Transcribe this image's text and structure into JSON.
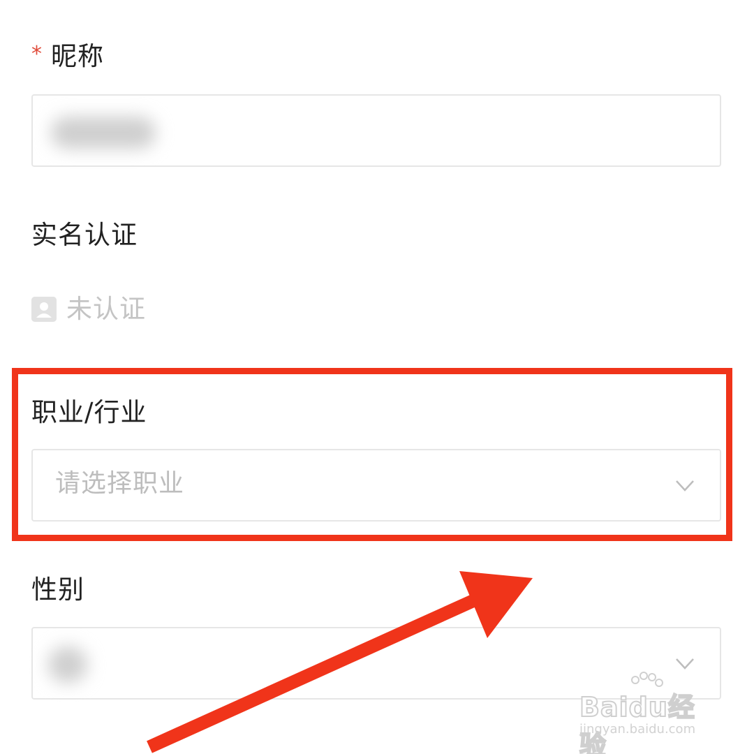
{
  "form": {
    "nickname": {
      "required_mark": "*",
      "label": "昵称",
      "value": ""
    },
    "verification": {
      "label": "实名认证",
      "status": "未认证",
      "icon": "id-card-icon"
    },
    "occupation": {
      "label": "职业/行业",
      "placeholder": "请选择职业",
      "icon": "chevron-down-icon"
    },
    "gender": {
      "label": "性别",
      "value": "",
      "icon": "chevron-down-icon"
    }
  },
  "annotation": {
    "highlight_color": "#f0341a",
    "arrow_color": "#f0341a"
  },
  "watermark": {
    "brand": "Baidu经验",
    "url": "jingyan.baidu.com"
  }
}
